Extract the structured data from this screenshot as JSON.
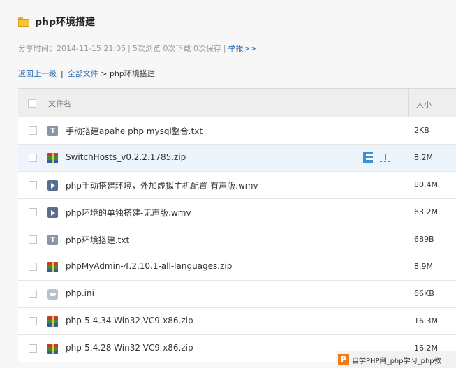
{
  "page": {
    "title": "php环境搭建",
    "meta": {
      "share_time": "分享时间：2014-11-15 21:05",
      "views": "5次浏览",
      "downloads": "0次下载",
      "saves": "0次保存",
      "report": "举报>>"
    },
    "breadcrumb": {
      "back": "返回上一级",
      "all_files": "全部文件",
      "current": "php环境搭建"
    }
  },
  "table": {
    "headers": {
      "name": "文件名",
      "size": "大小"
    },
    "files": [
      {
        "name": "手动搭建apahe php mysql整合.txt",
        "size": "2KB",
        "icon": "txt-file-icon"
      },
      {
        "name": "SwitchHosts_v0.2.2.1785.zip",
        "size": "8.2M",
        "icon": "zip-file-icon"
      },
      {
        "name": "php手动搭建环境，外加虚拟主机配置-有声版.wmv",
        "size": "80.4M",
        "icon": "video-file-icon"
      },
      {
        "name": "php环境的单独搭建-无声版.wmv",
        "size": "63.2M",
        "icon": "video-file-icon"
      },
      {
        "name": "php环境搭建.txt",
        "size": "689B",
        "icon": "txt-file-icon"
      },
      {
        "name": "phpMyAdmin-4.2.10.1-all-languages.zip",
        "size": "8.9M",
        "icon": "zip-file-icon"
      },
      {
        "name": "php.ini",
        "size": "66KB",
        "icon": "config-file-icon"
      },
      {
        "name": "php-5.4.34-Win32-VC9-x86.zip",
        "size": "16.3M",
        "icon": "zip-file-icon"
      },
      {
        "name": "php-5.4.28-Win32-VC9-x86.zip",
        "size": "16.2M",
        "icon": "zip-file-icon"
      }
    ]
  },
  "watermark": {
    "logo": "P",
    "text": "自学PHP网_php学习_php教"
  },
  "colors": {
    "link": "#2e6db4",
    "hover_row": "#eef4fb",
    "accent": "#3d8fd6"
  }
}
